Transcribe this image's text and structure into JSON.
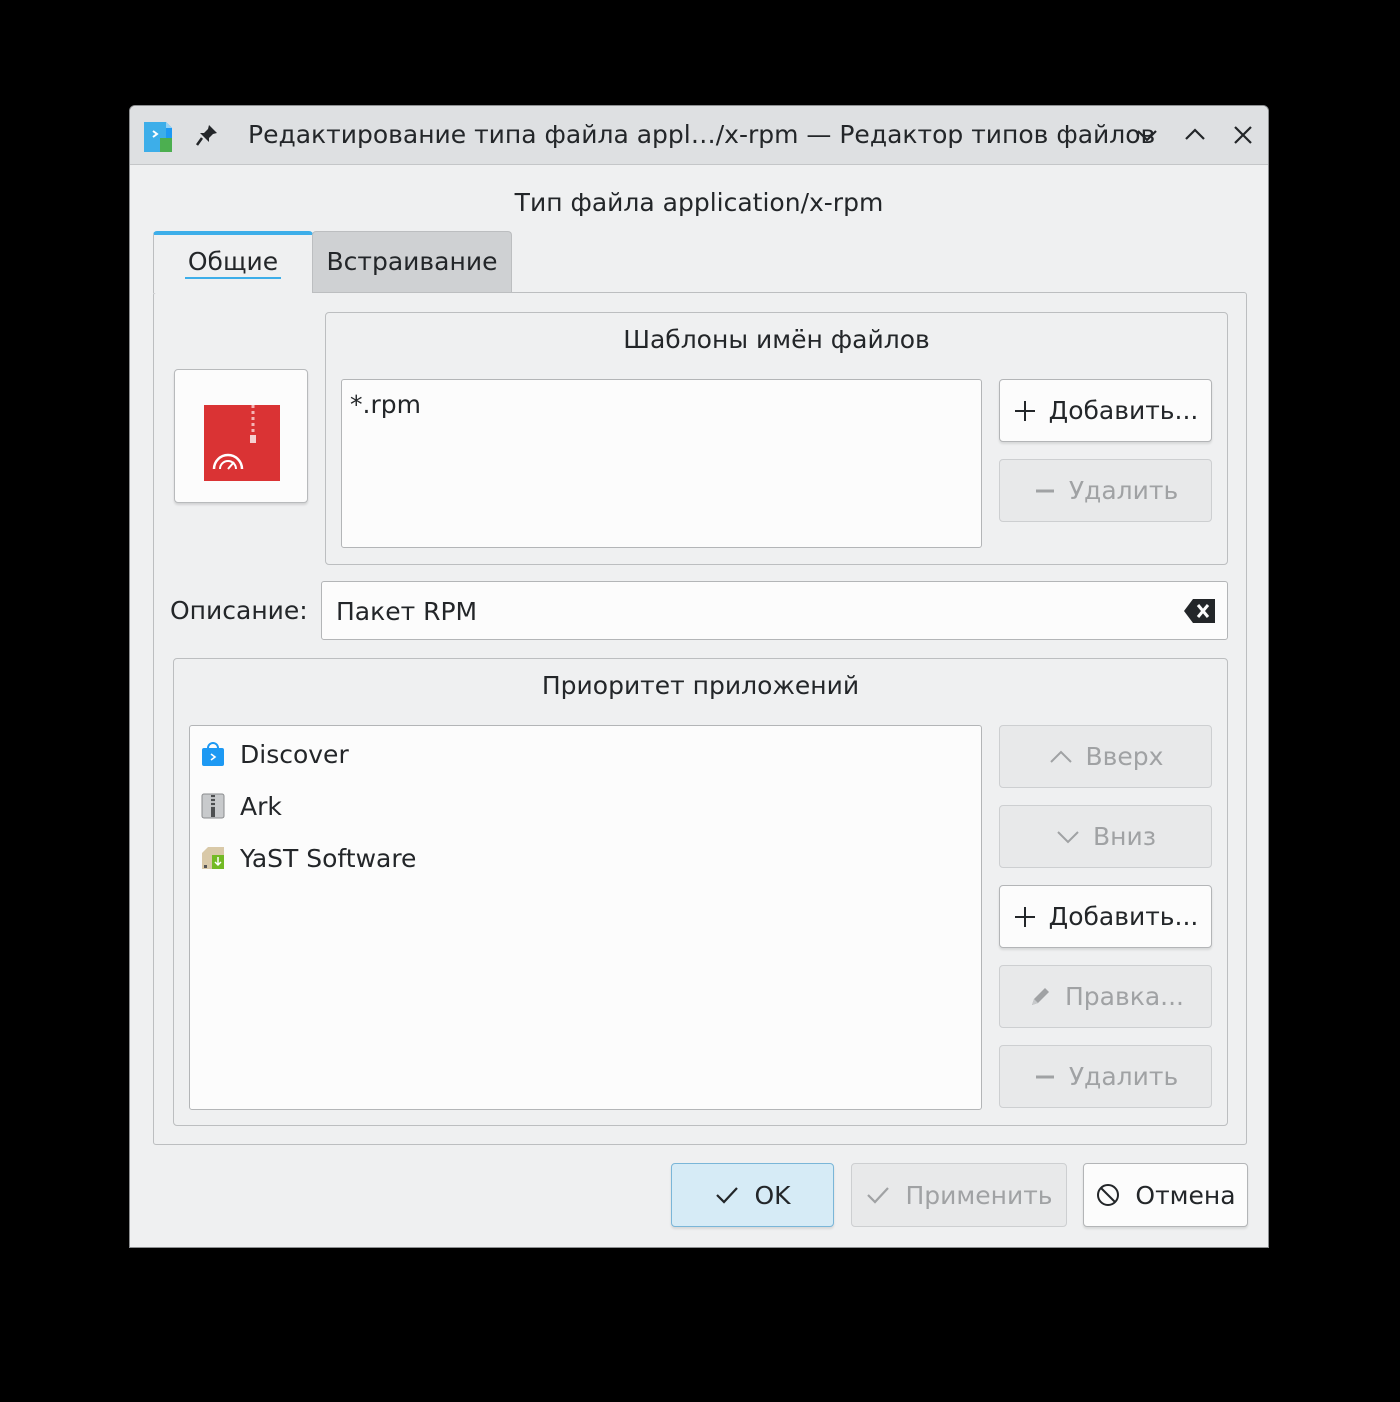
{
  "window": {
    "title": "Редактирование типа файла appl…/x-rpm — Редактор типов файлов"
  },
  "dialog": {
    "header": "Тип файла application/x-rpm"
  },
  "tabs": [
    {
      "label": "Общие",
      "active": true
    },
    {
      "label": "Встраивание",
      "active": false
    }
  ],
  "patterns": {
    "title": "Шаблоны имён файлов",
    "items": [
      "*.rpm"
    ],
    "add_label": "Добавить...",
    "remove_label": "Удалить"
  },
  "description": {
    "label": "Описание:",
    "value": "Пакет RPM"
  },
  "app_priority": {
    "title": "Приоритет приложений",
    "apps": [
      {
        "name": "Discover",
        "icon": "discover-icon"
      },
      {
        "name": "Ark",
        "icon": "ark-icon"
      },
      {
        "name": "YaST Software",
        "icon": "yast-software-icon"
      }
    ],
    "up_label": "Вверх",
    "down_label": "Вниз",
    "add_label": "Добавить...",
    "edit_label": "Правка...",
    "remove_label": "Удалить"
  },
  "footer": {
    "ok_label": "OK",
    "apply_label": "Применить",
    "cancel_label": "Отмена"
  },
  "colors": {
    "accent": "#3daee9",
    "file_icon_red": "#da3334",
    "window_bg": "#eff0f1"
  }
}
